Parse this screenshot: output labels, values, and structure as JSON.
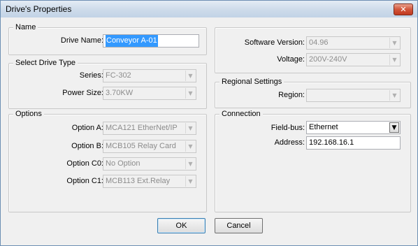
{
  "window": {
    "title": "Drive's Properties",
    "close_glyph": "✕"
  },
  "name_group": {
    "legend": "Name",
    "drive_name_label": "Drive Name:",
    "drive_name_value": "Conveyor A-01"
  },
  "drive_type_group": {
    "legend": "Select Drive Type",
    "series_label": "Series:",
    "series_value": "FC-302",
    "power_label": "Power Size:",
    "power_value": "3.70KW"
  },
  "options_group": {
    "legend": "Options",
    "option_a_label": "Option A:",
    "option_a_value": "MCA121 EtherNet/IP",
    "option_b_label": "Option B:",
    "option_b_value": "MCB105 Relay Card",
    "option_c0_label": "Option C0:",
    "option_c0_value": "No Option",
    "option_c1_label": "Option C1:",
    "option_c1_value": "MCB113 Ext.Relay"
  },
  "software_group": {
    "software_label": "Software Version:",
    "software_value": "04.96",
    "voltage_label": "Voltage:",
    "voltage_value": "200V-240V"
  },
  "regional_group": {
    "legend": "Regional Settings",
    "region_label": "Region:",
    "region_value": ""
  },
  "connection_group": {
    "legend": "Connection",
    "fieldbus_label": "Field-bus:",
    "fieldbus_value": "Ethernet",
    "address_label": "Address:",
    "address_value": "192.168.16.1"
  },
  "buttons": {
    "ok": "OK",
    "cancel": "Cancel"
  },
  "icons": {
    "dropdown_arrow": "▼"
  },
  "colors": {
    "title_bar": "#cddbea",
    "close_button": "#d2553a",
    "selection": "#3399ff",
    "window_border": "#6d8fb3"
  }
}
